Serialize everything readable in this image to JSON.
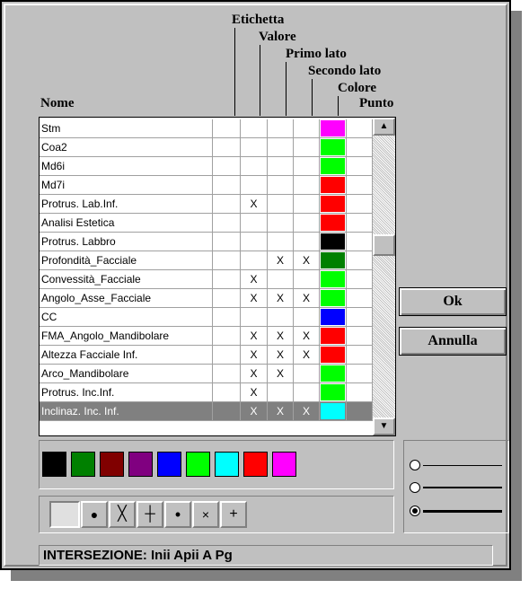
{
  "headers": {
    "nome": "Nome",
    "etichetta": "Etichetta",
    "valore": "Valore",
    "primo_lato": "Primo lato",
    "secondo_lato": "Secondo lato",
    "colore": "Colore",
    "punto": "Punto"
  },
  "rows": [
    {
      "name": "Stm",
      "etichetta": "",
      "valore": "",
      "primo_lato": "",
      "secondo_lato": "",
      "colore": "#ff00ff",
      "selected": false
    },
    {
      "name": "Coa2",
      "etichetta": "",
      "valore": "",
      "primo_lato": "",
      "secondo_lato": "",
      "colore": "#00ff00",
      "selected": false
    },
    {
      "name": "Md6i",
      "etichetta": "",
      "valore": "",
      "primo_lato": "",
      "secondo_lato": "",
      "colore": "#00ff00",
      "selected": false
    },
    {
      "name": "Md7i",
      "etichetta": "",
      "valore": "",
      "primo_lato": "",
      "secondo_lato": "",
      "colore": "#ff0000",
      "selected": false
    },
    {
      "name": "Protrus. Lab.Inf.",
      "etichetta": "",
      "valore": "X",
      "primo_lato": "",
      "secondo_lato": "",
      "colore": "#ff0000",
      "selected": false
    },
    {
      "name": "Analisi Estetica",
      "etichetta": "",
      "valore": "",
      "primo_lato": "",
      "secondo_lato": "",
      "colore": "#ff0000",
      "selected": false
    },
    {
      "name": "Protrus. Labbro",
      "etichetta": "",
      "valore": "",
      "primo_lato": "",
      "secondo_lato": "",
      "colore": "#000000",
      "selected": false
    },
    {
      "name": "Profondità_Facciale",
      "etichetta": "",
      "valore": "",
      "primo_lato": "X",
      "secondo_lato": "X",
      "colore": "#008000",
      "selected": false
    },
    {
      "name": "Convessità_Facciale",
      "etichetta": "",
      "valore": "X",
      "primo_lato": "",
      "secondo_lato": "",
      "colore": "#00ff00",
      "selected": false
    },
    {
      "name": "Angolo_Asse_Facciale",
      "etichetta": "",
      "valore": "X",
      "primo_lato": "X",
      "secondo_lato": "X",
      "colore": "#00ff00",
      "selected": false
    },
    {
      "name": "CC",
      "etichetta": "",
      "valore": "",
      "primo_lato": "",
      "secondo_lato": "",
      "colore": "#0000ff",
      "selected": false
    },
    {
      "name": "FMA_Angolo_Mandibolare",
      "etichetta": "",
      "valore": "X",
      "primo_lato": "X",
      "secondo_lato": "X",
      "colore": "#ff0000",
      "selected": false
    },
    {
      "name": "Altezza Facciale Inf.",
      "etichetta": "",
      "valore": "X",
      "primo_lato": "X",
      "secondo_lato": "X",
      "colore": "#ff0000",
      "selected": false
    },
    {
      "name": "Arco_Mandibolare",
      "etichetta": "",
      "valore": "X",
      "primo_lato": "X",
      "secondo_lato": "",
      "colore": "#00ff00",
      "selected": false
    },
    {
      "name": "Protrus. Inc.Inf.",
      "etichetta": "",
      "valore": "X",
      "primo_lato": "",
      "secondo_lato": "",
      "colore": "#00ff00",
      "selected": false
    },
    {
      "name": "Inclinaz. Inc. Inf.",
      "etichetta": "",
      "valore": "X",
      "primo_lato": "X",
      "secondo_lato": "X",
      "colore": "#00ffff",
      "selected": true
    }
  ],
  "scrollbar": {
    "up_icon": "arrow-up-icon",
    "down_icon": "arrow-down-icon",
    "up_glyph": "▲",
    "down_glyph": "▼"
  },
  "buttons": {
    "ok": "Ok",
    "annulla": "Annulla"
  },
  "palette": [
    "#000000",
    "#008000",
    "#800000",
    "#800080",
    "#0000ff",
    "#00ff00",
    "#00ffff",
    "#ff0000",
    "#ff00ff"
  ],
  "symbols": [
    {
      "name": "none-icon",
      "glyph": ""
    },
    {
      "name": "large-dot-icon",
      "glyph": "●"
    },
    {
      "name": "large-x-icon",
      "glyph": "╳"
    },
    {
      "name": "large-plus-icon",
      "glyph": "┼"
    },
    {
      "name": "small-dot-icon",
      "glyph": "•"
    },
    {
      "name": "small-x-icon",
      "glyph": "×"
    },
    {
      "name": "small-plus-icon",
      "glyph": "+"
    }
  ],
  "line_widths": [
    {
      "name": "thin-line",
      "selected": false
    },
    {
      "name": "medium-line",
      "selected": false
    },
    {
      "name": "thick-line",
      "selected": true
    }
  ],
  "status": "INTERSEZIONE: Inii Apii A Pg"
}
